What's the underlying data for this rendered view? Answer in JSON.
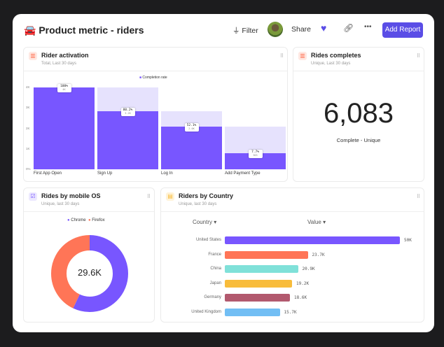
{
  "header": {
    "title": "Product metric - riders",
    "filter": "Filter",
    "share": "Share",
    "add_report": "Add Report"
  },
  "colors": {
    "accent": "#5a4de6",
    "bar": "#7856ff",
    "bar_light": "#e6e2fd"
  },
  "rider_activation": {
    "title": "Rider activation",
    "subtitle": "Total, Last 30 days",
    "legend": "Completion rate",
    "chart_data": {
      "type": "bar",
      "y_ticks": [
        "0%",
        "1K",
        "2K",
        "3K",
        "4K"
      ],
      "ylim": [
        0,
        4000
      ],
      "categories": [
        "First App Open",
        "Sign Up",
        "Log In",
        "Add Payment Type"
      ],
      "values": [
        4000,
        2850,
        2100,
        800
      ],
      "rate_labels": [
        "100%",
        "80.2%",
        "52.1%",
        "7.7%"
      ],
      "count_labels": [
        "4K",
        "3.2K",
        "2.0K",
        "303"
      ]
    }
  },
  "rides_completes": {
    "title": "Rides completes",
    "subtitle": "Unique, Last 30 days",
    "value": "6,083",
    "caption": "Complete - Unique"
  },
  "mobile_os": {
    "title": "Rides by mobile OS",
    "subtitle": "Unique, last 30 days",
    "center": "29.6K",
    "chart_data": {
      "type": "pie",
      "labels": [
        "Chrome",
        "Firefox"
      ],
      "values": [
        57,
        43
      ],
      "colors": [
        "#7856ff",
        "#ff7557"
      ]
    }
  },
  "country": {
    "title": "Riders by Country",
    "subtitle": "Unique, last 30 days",
    "col_country": "Country",
    "col_value": "Value",
    "chart_data": {
      "type": "bar",
      "orientation": "horizontal",
      "categories": [
        "United States",
        "France",
        "China",
        "Japan",
        "Germany",
        "United Kingdom"
      ],
      "values": [
        50000,
        23700,
        20900,
        19200,
        18600,
        15700
      ],
      "labels": [
        "50K",
        "23.7K",
        "20.9K",
        "19.2K",
        "18.6K",
        "15.7K"
      ],
      "colors": [
        "#7856ff",
        "#ff7557",
        "#80e1d9",
        "#f8bc3b",
        "#b2596e",
        "#72bef4"
      ]
    }
  }
}
